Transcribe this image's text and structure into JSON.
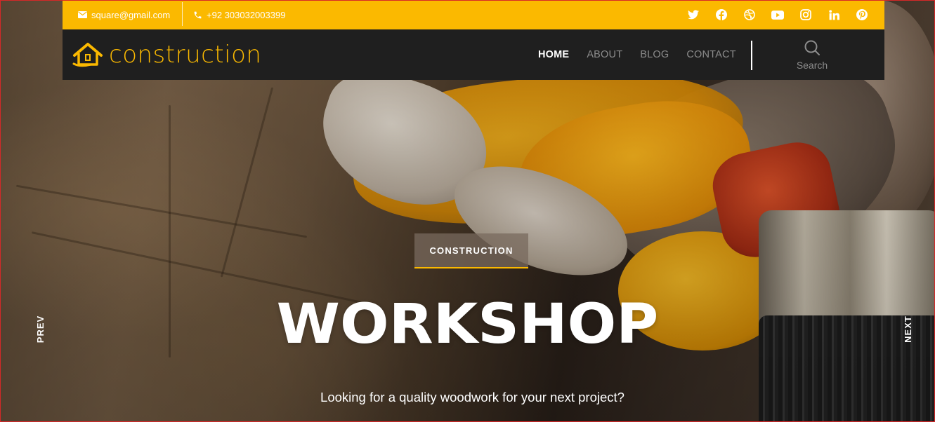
{
  "topbar": {
    "email": "square@gmail.com",
    "phone": "+92 303032003399",
    "socials": [
      "twitter-icon",
      "facebook-icon",
      "dribbble-icon",
      "youtube-icon",
      "instagram-icon",
      "linkedin-icon",
      "pinterest-icon"
    ]
  },
  "navbar": {
    "logo_text": "construction",
    "menu": [
      {
        "label": "HOME",
        "active": true
      },
      {
        "label": "ABOUT",
        "active": false
      },
      {
        "label": "BLOG",
        "active": false
      },
      {
        "label": "CONTACT",
        "active": false
      }
    ],
    "search_label": "Search"
  },
  "hero": {
    "tag": "CONSTRUCTION",
    "title": "WORKSHOP",
    "subtitle": "Looking for a quality woodwork for your next project?",
    "prev_label": "PREV",
    "next_label": "NEXT"
  },
  "colors": {
    "accent": "#fbb900",
    "navbar_bg": "#1f1f1f",
    "menu_inactive": "#8d8d8d",
    "border": "#d62828"
  }
}
